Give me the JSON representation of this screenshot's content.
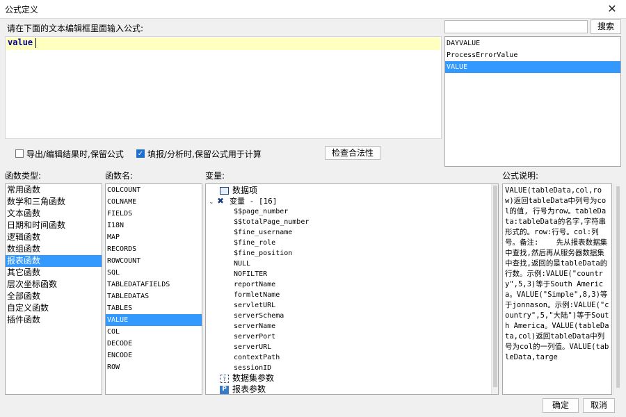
{
  "window": {
    "title": "公式定义"
  },
  "editor": {
    "prompt": "请在下面的文本编辑框里面输入公式:",
    "content": "value"
  },
  "search": {
    "value": "",
    "button_label": "搜索"
  },
  "suggestions": {
    "items": [
      "DAYVALUE",
      "ProcessErrorValue",
      "VALUE"
    ],
    "selected_index": 2
  },
  "options": {
    "keep_formula_export": {
      "label": "导出/编辑结果时,保留公式",
      "checked": false
    },
    "keep_formula_fill": {
      "label": "填报/分析时,保留公式用于计算",
      "checked": true
    },
    "check_button_label": "检查合法性"
  },
  "function_types": {
    "header": "函数类型:",
    "items": [
      "常用函数",
      "数学和三角函数",
      "文本函数",
      "日期和时间函数",
      "逻辑函数",
      "数组函数",
      "报表函数",
      "其它函数",
      "层次坐标函数",
      "全部函数",
      "自定义函数",
      "插件函数"
    ],
    "selected_index": 6
  },
  "function_names": {
    "header": "函数名:",
    "items": [
      "COLCOUNT",
      "COLNAME",
      "FIELDS",
      "I18N",
      "MAP",
      "RECORDS",
      "ROWCOUNT",
      "SQL",
      "TABLEDATAFIELDS",
      "TABLEDATAS",
      "TABLES",
      "VALUE",
      "COL",
      "DECODE",
      "ENCODE",
      "ROW"
    ],
    "selected_index": 11
  },
  "variables": {
    "header": "变量:",
    "data_items_label": "数据项",
    "variables_group_label": "变量 - [16]",
    "variables": [
      "$$page_number",
      "$$totalPage_number",
      "$fine_username",
      "$fine_role",
      "$fine_position",
      "NULL",
      "NOFILTER",
      "reportName",
      "formletName",
      "servletURL",
      "serverSchema",
      "serverName",
      "serverPort",
      "serverURL",
      "contextPath",
      "sessionID"
    ],
    "dataset_params_label": "数据集参数",
    "report_params_label": "报表参数"
  },
  "description": {
    "header": "公式说明:",
    "text": "VALUE(tableData,col,row)返回tableData中列号为col的值, 行号为row。tableData:tableData的名字,字符串形式的。row:行号。col:列号。备注:    先从报表数据集中查找,然后再从服务器数据集中查找,返回的是tableData的行数。示例:VALUE(\"country\",5,3)等于South America。VALUE(\"Simple\",8,3)等于jonnason。示例:VALUE(\"country\",5,\"大陆\")等于South America。VALUE(tableData,col)返回tableData中列号为col的一列值。VALUE(tableData,targe"
  },
  "footer": {
    "ok_label": "确定",
    "cancel_label": "取消"
  },
  "colors": {
    "selection": "#3399ff",
    "editor_line": "#ffffc0",
    "editor_text": "#00008b"
  }
}
